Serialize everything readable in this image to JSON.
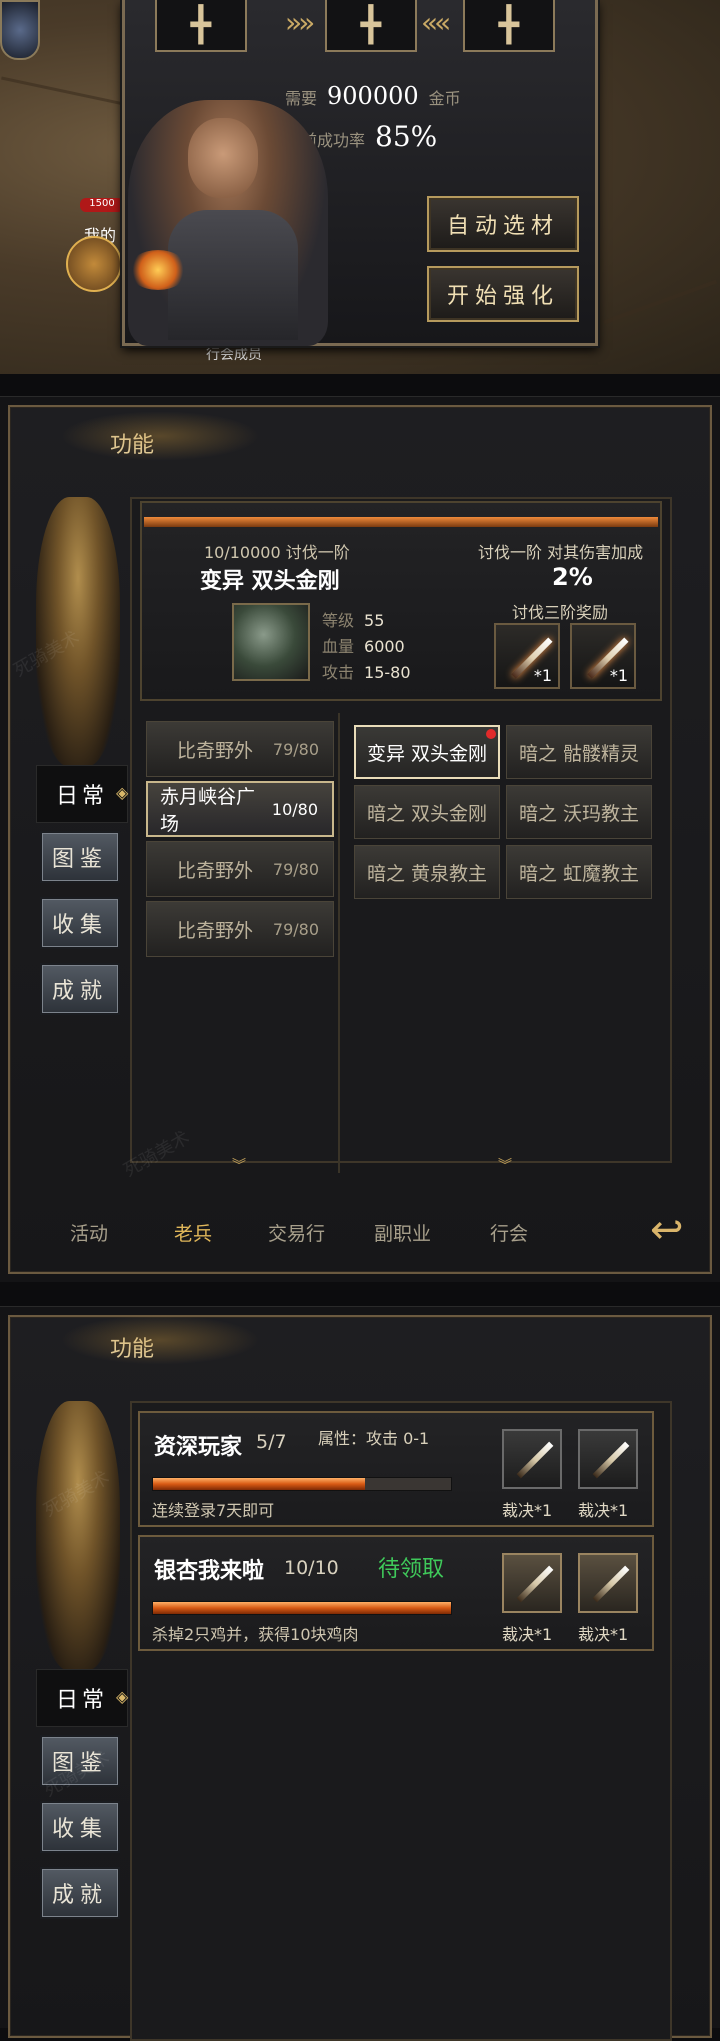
{
  "forge": {
    "cost_label": "需要",
    "cost_value": "900000",
    "cost_unit": "金币",
    "rate_label": "当前成功率",
    "rate_value": "85%",
    "auto_select_label": "自动选材",
    "start_enhance_label": "开始强化",
    "hp_badge": "1500",
    "mine_label": "我的",
    "bottom_text": "行会成员"
  },
  "panel1": {
    "title": "功能",
    "sidebar": {
      "active": "日常",
      "items": [
        "图鉴",
        "收集",
        "成就"
      ]
    },
    "boss": {
      "progress": "10/10000 讨伐一阶",
      "name": "变异 双头金刚",
      "stats": [
        {
          "label": "等级",
          "value": "55"
        },
        {
          "label": "血量",
          "value": "6000"
        },
        {
          "label": "攻击",
          "value": "15-80"
        }
      ],
      "bonus_label": "讨伐一阶 对其伤害加成",
      "bonus_value": "2%",
      "reward_label": "讨伐三阶奖励",
      "rewards": [
        {
          "count": "*1"
        },
        {
          "count": "*1"
        }
      ]
    },
    "maps": [
      {
        "name": "比奇野外",
        "count": "79/80"
      },
      {
        "name": "赤月峡谷广场",
        "count": "10/80"
      },
      {
        "name": "比奇野外",
        "count": "79/80"
      },
      {
        "name": "比奇野外",
        "count": "79/80"
      }
    ],
    "bosses": [
      "变异 双头金刚",
      "暗之 骷髅精灵",
      "暗之 双头金刚",
      "暗之 沃玛教主",
      "暗之 黄泉教主",
      "暗之 虹魔教主"
    ],
    "tabs": [
      "活动",
      "老兵",
      "交易行",
      "副职业",
      "行会"
    ],
    "active_tab": "老兵"
  },
  "panel2": {
    "title": "功能",
    "sidebar": {
      "active": "日常",
      "items": [
        "图鉴",
        "收集",
        "成就"
      ]
    },
    "quests": [
      {
        "title": "资深玩家",
        "progress": "5/7",
        "progress_fraction": 0.71,
        "attr": "属性：攻击 0-1",
        "desc": "连续登录7天即可",
        "rewards": [
          "裁决*1",
          "裁决*1"
        ]
      },
      {
        "title": "银杏我来啦",
        "progress": "10/10",
        "progress_fraction": 1.0,
        "status": "待领取",
        "desc": "杀掉2只鸡并，获得10块鸡肉",
        "rewards": [
          "裁决*1",
          "裁决*1"
        ]
      }
    ]
  },
  "watermark": "死骑美术"
}
